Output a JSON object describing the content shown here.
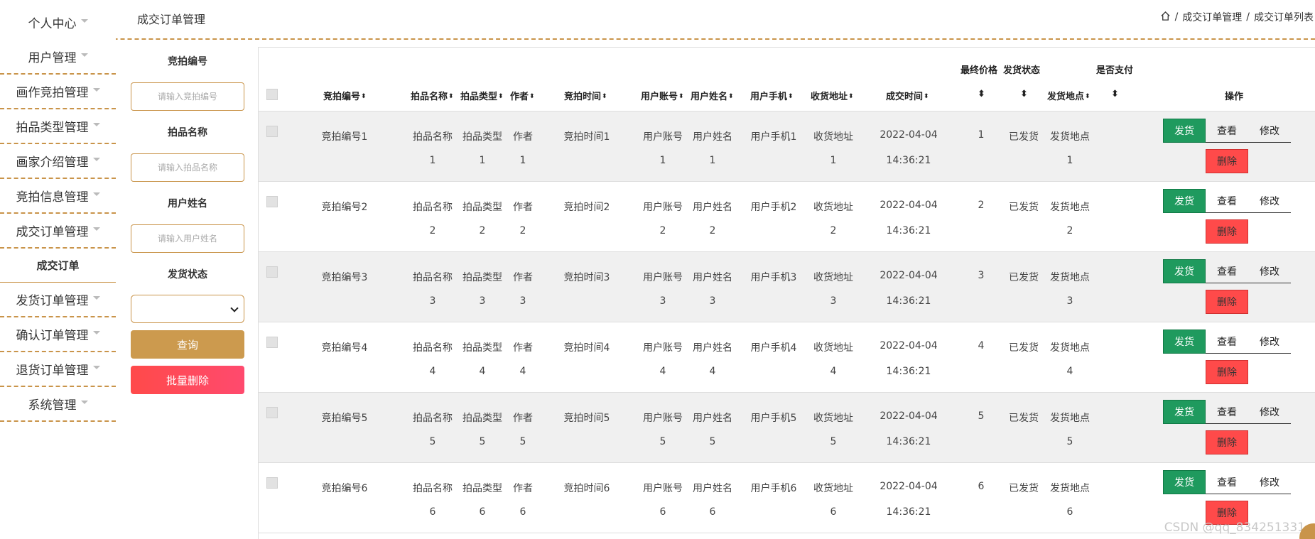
{
  "sidebar": {
    "items": [
      {
        "label": "个人中心"
      },
      {
        "label": "用户管理"
      },
      {
        "label": "画作竞拍管理"
      },
      {
        "label": "拍品类型管理"
      },
      {
        "label": "画家介绍管理"
      },
      {
        "label": "竞拍信息管理"
      },
      {
        "label": "成交订单管理"
      },
      {
        "label": "成交订单"
      },
      {
        "label": "发货订单管理"
      },
      {
        "label": "确认订单管理"
      },
      {
        "label": "退货订单管理"
      },
      {
        "label": "系统管理"
      }
    ]
  },
  "header": {
    "title": "成交订单管理",
    "breadcrumb": [
      "成交订单管理",
      "成交订单列表"
    ],
    "separator": "/"
  },
  "search": {
    "auction_no_label": "竞拍编号",
    "auction_no_placeholder": "请输入竞拍编号",
    "item_name_label": "拍品名称",
    "item_name_placeholder": "请输入拍品名称",
    "user_name_label": "用户姓名",
    "user_name_placeholder": "请输入用户姓名",
    "ship_status_label": "发货状态",
    "ship_status_value": "",
    "query_button": "查询",
    "bulk_delete_button": "批量删除"
  },
  "table": {
    "headers": {
      "auction_no": "竞拍编号",
      "item_name": "拍品名称",
      "item_type": "拍品类型",
      "author": "作者",
      "auction_time": "竞拍时间",
      "user_account": "用户账号",
      "user_name": "用户姓名",
      "user_phone": "用户手机",
      "address": "收货地址",
      "deal_time": "成交时间",
      "final_price": "最终价格",
      "ship_status": "发货状态",
      "ship_place": "发货地点",
      "paid": "是否支付",
      "actions": "操作"
    },
    "sort_glyph": "⬍",
    "action_labels": {
      "ship": "发货",
      "view": "查看",
      "edit": "修改",
      "delete": "删除"
    },
    "rows": [
      {
        "auction_no": "竞拍编号1",
        "item_name": [
          "拍品名称",
          "1"
        ],
        "item_type": [
          "拍品类型",
          "1"
        ],
        "author": [
          "作者",
          "1"
        ],
        "auction_time": "竞拍时间1",
        "user_account": [
          "用户账号",
          "1"
        ],
        "user_name": [
          "用户姓名",
          "1"
        ],
        "user_phone": "用户手机1",
        "address": [
          "收货地址",
          "1"
        ],
        "deal_time": [
          "2022-04-04",
          "14:36:21"
        ],
        "final_price": "1",
        "ship_status": "已发货",
        "ship_place": [
          "发货地点",
          "1"
        ]
      },
      {
        "auction_no": "竞拍编号2",
        "item_name": [
          "拍品名称",
          "2"
        ],
        "item_type": [
          "拍品类型",
          "2"
        ],
        "author": [
          "作者",
          "2"
        ],
        "auction_time": "竞拍时间2",
        "user_account": [
          "用户账号",
          "2"
        ],
        "user_name": [
          "用户姓名",
          "2"
        ],
        "user_phone": "用户手机2",
        "address": [
          "收货地址",
          "2"
        ],
        "deal_time": [
          "2022-04-04",
          "14:36:21"
        ],
        "final_price": "2",
        "ship_status": "已发货",
        "ship_place": [
          "发货地点",
          "2"
        ]
      },
      {
        "auction_no": "竞拍编号3",
        "item_name": [
          "拍品名称",
          "3"
        ],
        "item_type": [
          "拍品类型",
          "3"
        ],
        "author": [
          "作者",
          "3"
        ],
        "auction_time": "竞拍时间3",
        "user_account": [
          "用户账号",
          "3"
        ],
        "user_name": [
          "用户姓名",
          "3"
        ],
        "user_phone": "用户手机3",
        "address": [
          "收货地址",
          "3"
        ],
        "deal_time": [
          "2022-04-04",
          "14:36:21"
        ],
        "final_price": "3",
        "ship_status": "已发货",
        "ship_place": [
          "发货地点",
          "3"
        ]
      },
      {
        "auction_no": "竞拍编号4",
        "item_name": [
          "拍品名称",
          "4"
        ],
        "item_type": [
          "拍品类型",
          "4"
        ],
        "author": [
          "作者",
          "4"
        ],
        "auction_time": "竞拍时间4",
        "user_account": [
          "用户账号",
          "4"
        ],
        "user_name": [
          "用户姓名",
          "4"
        ],
        "user_phone": "用户手机4",
        "address": [
          "收货地址",
          "4"
        ],
        "deal_time": [
          "2022-04-04",
          "14:36:21"
        ],
        "final_price": "4",
        "ship_status": "已发货",
        "ship_place": [
          "发货地点",
          "4"
        ]
      },
      {
        "auction_no": "竞拍编号5",
        "item_name": [
          "拍品名称",
          "5"
        ],
        "item_type": [
          "拍品类型",
          "5"
        ],
        "author": [
          "作者",
          "5"
        ],
        "auction_time": "竞拍时间5",
        "user_account": [
          "用户账号",
          "5"
        ],
        "user_name": [
          "用户姓名",
          "5"
        ],
        "user_phone": "用户手机5",
        "address": [
          "收货地址",
          "5"
        ],
        "deal_time": [
          "2022-04-04",
          "14:36:21"
        ],
        "final_price": "5",
        "ship_status": "已发货",
        "ship_place": [
          "发货地点",
          "5"
        ]
      },
      {
        "auction_no": "竞拍编号6",
        "item_name": [
          "拍品名称",
          "6"
        ],
        "item_type": [
          "拍品类型",
          "6"
        ],
        "author": [
          "作者",
          "6"
        ],
        "auction_time": "竞拍时间6",
        "user_account": [
          "用户账号",
          "6"
        ],
        "user_name": [
          "用户姓名",
          "6"
        ],
        "user_phone": "用户手机6",
        "address": [
          "收货地址",
          "6"
        ],
        "deal_time": [
          "2022-04-04",
          "14:36:21"
        ],
        "final_price": "6",
        "ship_status": "已发货",
        "ship_place": [
          "发货地点",
          "6"
        ]
      }
    ]
  },
  "watermark": "CSDN @qq_834251331",
  "colors": {
    "accent": "#c9944a",
    "query_button": "#cc9a4e",
    "ship_button": "#1f9a5e",
    "delete_button": "#ff4a4a"
  }
}
